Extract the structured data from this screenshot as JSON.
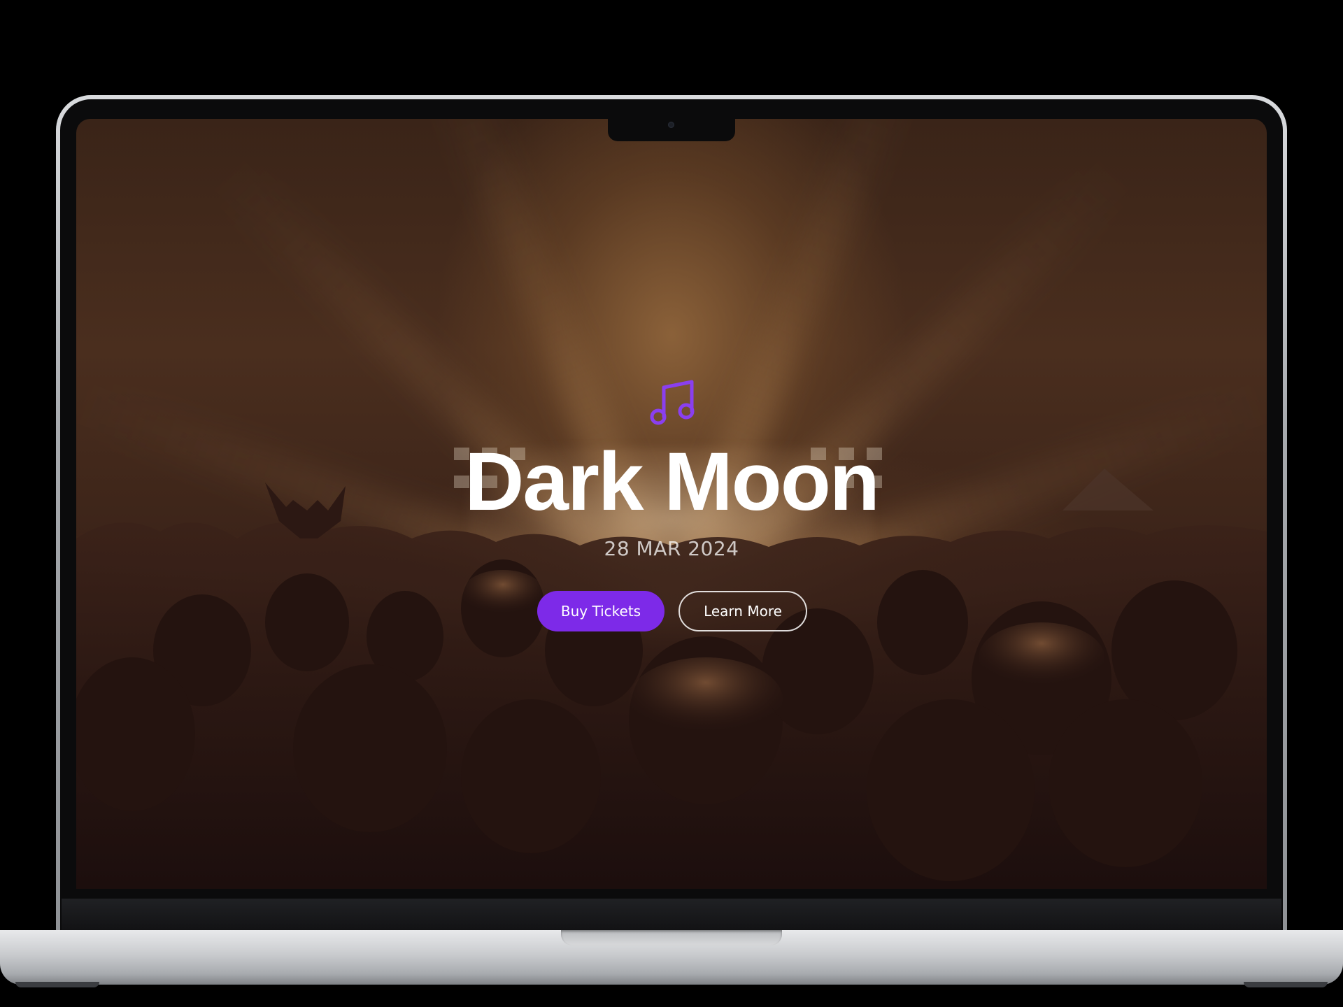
{
  "hero": {
    "icon": "music-note-icon",
    "title": "Dark Moon",
    "date": "28 MAR 2024",
    "primary_button": "Buy Tickets",
    "secondary_button": "Learn More"
  },
  "colors": {
    "accent": "#7d2ae8",
    "text": "#ffffff",
    "background_tint": "#2a1614"
  }
}
